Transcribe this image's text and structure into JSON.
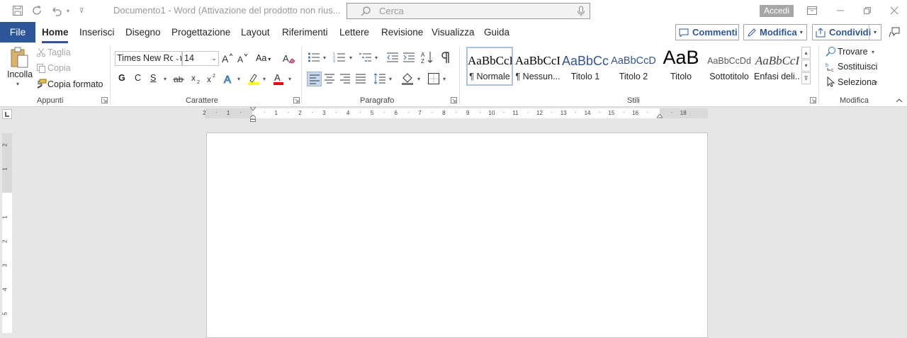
{
  "window": {
    "title": "Documento1  -  Word (Attivazione del prodotto non rius...",
    "search_placeholder": "Cerca",
    "signin_label": "Accedi"
  },
  "tabs": {
    "file": "File",
    "items": [
      "Home",
      "Inserisci",
      "Disegno",
      "Progettazione",
      "Layout",
      "Riferimenti",
      "Lettere",
      "Revisione",
      "Visualizza",
      "Guida"
    ],
    "active": "Home"
  },
  "top_actions": {
    "comments": "Commenti",
    "edit": "Modifica",
    "share": "Condividi"
  },
  "clipboard": {
    "group_label": "Appunti",
    "paste": "Incolla",
    "cut": "Taglia",
    "copy": "Copia",
    "format_painter": "Copia formato"
  },
  "font": {
    "group_label": "Carattere",
    "font_name": "Times New Roman",
    "font_size": "14",
    "bold": "G",
    "italic": "C",
    "underline": "S",
    "change_case": "Aa"
  },
  "paragraph": {
    "group_label": "Paragrafo"
  },
  "styles": {
    "group_label": "Stili",
    "items": [
      {
        "preview": "AaBbCcI",
        "name": "¶ Normale"
      },
      {
        "preview": "AaBbCcI",
        "name": "¶ Nessun..."
      },
      {
        "preview": "AaBbCc",
        "name": "Titolo 1"
      },
      {
        "preview": "AaBbCcD",
        "name": "Titolo 2"
      },
      {
        "preview": "AaB",
        "name": "Titolo"
      },
      {
        "preview": "AaBbCcDd",
        "name": "Sottotitolo"
      },
      {
        "preview": "AaBbCcI",
        "name": "Enfasi deli..."
      }
    ]
  },
  "editing": {
    "group_label": "Modifica",
    "find": "Trovare",
    "replace": "Sostituisci",
    "select": "Seleziona"
  },
  "ruler": {
    "h_numbers": [
      "2",
      "1",
      "1",
      "2",
      "3",
      "4",
      "5",
      "6",
      "7",
      "8",
      "9",
      "10",
      "11",
      "12",
      "13",
      "14",
      "15",
      "16",
      "18"
    ],
    "v_numbers": [
      "2",
      "1",
      "1",
      "2",
      "3",
      "4",
      "5"
    ]
  },
  "colors": {
    "accent": "#2b579a",
    "highlight": "#ffff00",
    "font_color": "#ff0000"
  }
}
